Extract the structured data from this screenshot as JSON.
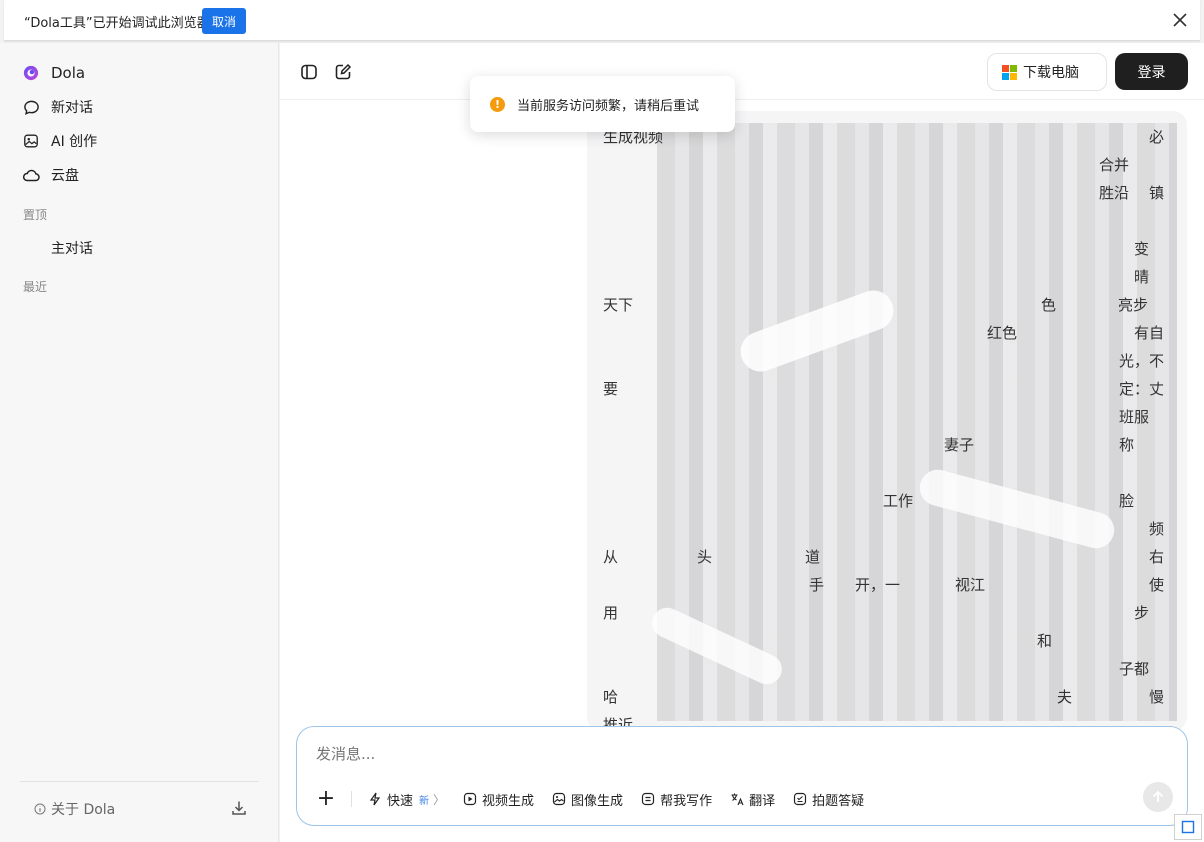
{
  "debug_bar": {
    "message": "“Dola工具”已开始调试此浏览器",
    "cancel_label": "取消"
  },
  "sidebar": {
    "brand": "Dola",
    "items": [
      {
        "label": "新对话",
        "icon": "chat-bubble-icon"
      },
      {
        "label": "AI 创作",
        "icon": "image-icon"
      },
      {
        "label": "云盘",
        "icon": "cloud-icon"
      }
    ],
    "pinned_heading": "置顶",
    "pinned_items": [
      "主对话"
    ],
    "recent_heading": "最近",
    "about_label": "关于 Dola"
  },
  "topbar": {
    "download_label": "下载电脑",
    "login_label": "登录"
  },
  "toast": {
    "message": "当前服务访问频繁，请稍后重试"
  },
  "message_bubble": {
    "visible_fragments": [
      "生成视频",
      "必",
      "合并",
      "胜沿",
      "镇",
      "变",
      "晴",
      "天下",
      "色",
      "亮步",
      "红色",
      "有自",
      "光，不",
      "要",
      "定：丈",
      "班服",
      "妻子",
      "称",
      "工作",
      "脸",
      "频",
      "从",
      "头",
      "道",
      "右",
      "手",
      "开，一",
      "视江",
      "使",
      "用",
      "步",
      "和",
      "子都",
      "哈",
      "夫",
      "慢",
      "推近"
    ]
  },
  "composer": {
    "placeholder": "发消息...",
    "tools": [
      {
        "label": "快速",
        "badge": "新",
        "icon": "lightning-icon"
      },
      {
        "label": "视频生成",
        "icon": "video-icon"
      },
      {
        "label": "图像生成",
        "icon": "image-icon"
      },
      {
        "label": "帮我写作",
        "icon": "write-icon"
      },
      {
        "label": "翻译",
        "icon": "translate-icon"
      },
      {
        "label": "拍题答疑",
        "icon": "camera-question-icon"
      }
    ]
  },
  "colors": {
    "accent": "#1a73e8",
    "login_bg": "#1f1f1f",
    "warning": "#f59a0b",
    "composer_border": "#9fc4ea"
  }
}
